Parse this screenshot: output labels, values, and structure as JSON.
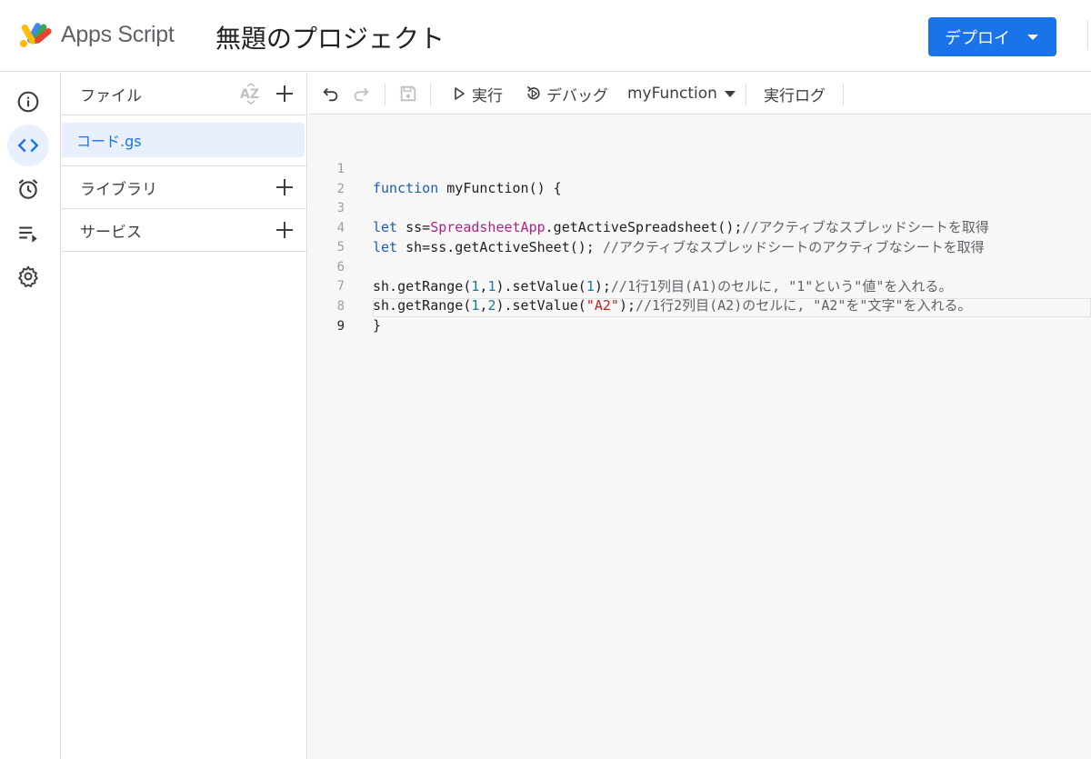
{
  "header": {
    "app_name": "Apps Script",
    "project_title": "無題のプロジェクト",
    "deploy_label": "デプロイ"
  },
  "rail": [
    {
      "name": "overview",
      "icon": "info-icon"
    },
    {
      "name": "editor",
      "icon": "code-icon",
      "active": true
    },
    {
      "name": "triggers",
      "icon": "alarm-clock-icon"
    },
    {
      "name": "executions",
      "icon": "executions-list-icon"
    },
    {
      "name": "settings",
      "icon": "gear-icon"
    }
  ],
  "files": {
    "files_label": "ファイル",
    "items": [
      {
        "name": "コード.gs"
      }
    ],
    "libraries_label": "ライブラリ",
    "services_label": "サービス"
  },
  "toolbar": {
    "run_label": "実行",
    "debug_label": "デバッグ",
    "function_name": "myFunction",
    "log_label": "実行ログ"
  },
  "editor": {
    "lines": [
      {
        "n": "1",
        "text": "function myFunction() {"
      },
      {
        "n": "2",
        "text": ""
      },
      {
        "n": "3",
        "text": "let ss=SpreadsheetApp.getActiveSpreadsheet();//アクティブなスプレッドシートを取得"
      },
      {
        "n": "4",
        "text": "let sh=ss.getActiveSheet(); //アクティブなスプレッドシートのアクティブなシートを取得"
      },
      {
        "n": "5",
        "text": ""
      },
      {
        "n": "6",
        "text": "sh.getRange(1,1).setValue(1);//1行1列目(A1)のセルに, \"1\"という\"値\"を入れる。"
      },
      {
        "n": "7",
        "text": "sh.getRange(1,2).setValue(\"A2\");//1行2列目(A2)のセルに, \"A2\"を\"文字\"を入れる。"
      },
      {
        "n": "8",
        "text": "}"
      },
      {
        "n": "9",
        "text": ""
      }
    ],
    "current_line": "9"
  },
  "colors": {
    "accent": "#1a73e8",
    "keyword": "#1a5fb4",
    "class": "#b3208a",
    "number": "#137d8f",
    "string": "#c5221f"
  }
}
